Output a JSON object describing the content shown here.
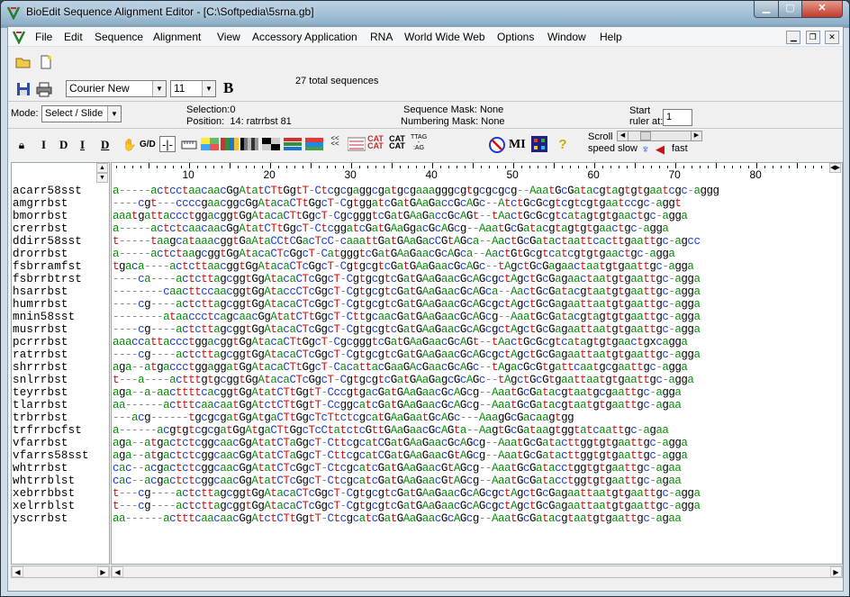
{
  "window": {
    "title": "BioEdit Sequence Alignment Editor - [C:\\Softpedia\\5srna.gb]"
  },
  "menu": [
    "File",
    "Edit",
    "Sequence",
    "Alignment",
    "View",
    "Accessory Application",
    "RNA",
    "World Wide Web",
    "Options",
    "Window",
    "Help"
  ],
  "toolbar": {
    "font_name": "Courier New",
    "font_size": "11",
    "bold_label": "B",
    "total_sequences": "27 total sequences"
  },
  "status": {
    "mode_label": "Mode:",
    "mode_value": "Select / Slide",
    "selection_label": "Selection:",
    "selection_value": "0",
    "position_label": "Position:",
    "position_value": "14:  ratrrbst  81",
    "sequence_mask": "Sequence Mask: None",
    "numbering_mask": "Numbering Mask: None",
    "start_ruler_label_1": "Start",
    "start_ruler_label_2": "ruler at:",
    "start_ruler_value": "1",
    "scroll_speed_1": "Scroll",
    "scroll_speed_2": "speed",
    "slow": "slow",
    "fast": "fast"
  },
  "tools_row": [
    "I",
    "D",
    "I",
    "D",
    "G/D",
    "MI"
  ],
  "ruler": [
    "10",
    "20",
    "30",
    "40",
    "50",
    "60",
    "70",
    "80"
  ],
  "sequences": [
    {
      "name": "acarr58sst",
      "seq": "a-----actcctaacaacGgAtatCTtGgtT-Ctcgcgaggcgatgcgaaagggcgtgcgcgcg--AaatGcGatacgtagtgtgaatcgc-aggg"
    },
    {
      "name": "amgrrbst",
      "seq": "----cgt---ccccgaacggcGgAtacaCTtGgcT-CgtggatcGatGAaGaccGcAGc--AtctGcGcgtcgtcgtgaatccgc-aggt"
    },
    {
      "name": "bmorrbst",
      "seq": "aaatgattaccctggacggtGgAtacaCTtGgcT-CgcgggtcGatGAaGaccGcAGt--tAactGcGcgtcatagtgtgaactgc-agga"
    },
    {
      "name": "crerrbst",
      "seq": "a-----actctcaacaacGgAtatCTtGgcT-CtcggatcGatGAaGgacGcAGcg--AaatGcGatacgtagtgtgaactgc-agga"
    },
    {
      "name": "ddirr58sst",
      "seq": "t-----taagcataaacggtGaAtaCCtCGacTcC-caaattGatGAaGacCGtAGca--AactGcGatactaattcacttgaattgc-agcc"
    },
    {
      "name": "drorrbst",
      "seq": "a-----actctaagcggtGgAtacaCTcGgcT-CatgggtcGatGAaGaacGcAGca--AactGtGcgtcatcgtgtgaactgc-agga"
    },
    {
      "name": "fsbrramfst",
      "seq": "tgaca----actcttaacggtGgAtacaCTcGgcT-CgtgcgtcGatGAaGaacGcAGc--tAgctGcGagaactaatgtgaattgc-agga"
    },
    {
      "name": "fsbrrbtrst",
      "seq": "----ca----actcttagcggtGgAtacaCTcGgcT-CgtgcgtcGatGAaGaacGcAGcgctAgctGcGagaactaatgtgaattgc-agga"
    },
    {
      "name": "hsarrbst",
      "seq": "--------caacttccaacggtGgAtaccCTcGgcT-CgtgcgtcGatGAaGaacGcAGca--AactGcGatacgtaatgtgaattgc-agga"
    },
    {
      "name": "humrrbst",
      "seq": "----cg----actcttagcggtGgAtacaCTcGgcT-CgtgcgtcGatGAaGaacGcAGcgctAgctGcGagaattaatgtgaattgc-agga"
    },
    {
      "name": "mnin58sst",
      "seq": "--------ataaccctcagcaacGgAtatCTtGgcT-CttgcaacGatGAaGaacGcAGcg--AaatGcGatacgtagtgtgaattgc-agga"
    },
    {
      "name": "musrrbst",
      "seq": "----cg----actcttagcggtGgAtacaCTcGgcT-CgtgcgtcGatGAaGaacGcAGcgctAgctGcGagaattaatgtgaattgc-agga"
    },
    {
      "name": "pcrrrbst",
      "seq": "aaaccattaccctggacggtGgAtacaCTtGgcT-CgcgggtcGatGAaGaacGcAGt--tAactGcGcgtcatagtgtgaactgxcagga"
    },
    {
      "name": "ratrrbst",
      "seq": "----cg----actcttagcggtGgAtacaCTcGgcT-CgtgcgtcGatGAaGaacGcAGcgctAgctGcGagaattaatgtgaattgc-agga"
    },
    {
      "name": "shrrrbst",
      "seq": "aga--atgaccctggaggatGgAtacaCTtGgcT-CacattacGaaGAcGaacGcAGc--tAgacGcGtgattcaatgcgaattgc-agga"
    },
    {
      "name": "snlrrbst",
      "seq": "t---a----actttgtgcggtGgAtacaCTcGgcT-CgtgcgtcGatGAaGagcGcAGc--tAgctGcGtgaattaatgtgaattgc-agga"
    },
    {
      "name": "teyrrbst",
      "seq": "aga--a-aacttttcacggtGgAtatCTtGgtT-CccgtgacGatGAaGaacGcAGcg--AaatGcGatacgtaatgcgaattgc-agga"
    },
    {
      "name": "tlarrbst",
      "seq": "aa------actttcaacaatGgAtctCTtGgtT-CcggcatcGatGAaGaacGcAGcg--AaatGcGatacgtaatgtgaattgc-agaa"
    },
    {
      "name": "trbrrbst",
      "seq": "---acg------tgcgcgatGgAtgaCTtGgcTcTtctcgcatGAaGaatGcAGc---AaagGcGacaagtgg"
    },
    {
      "name": "trfrrbcfst",
      "seq": "a------acgtgtcgcgatGgAtgaCTtGgcTcCtatctcGttGAaGaacGcAGta--AagtGcGataagtggtatcaattgc-agaa"
    },
    {
      "name": "vfarrbst",
      "seq": "aga--atgactctcggcaacGgAtatCTaGgcT-CttcgcatCGatGAaGaacGcAGcg--AaatGcGatacttggtgtgaattgc-agga"
    },
    {
      "name": "vfarrs58sst",
      "seq": "aga--atgactctcggcaacGgAtatCTaGgcT-CttcgcatCGatGAaGaacGtAGcg--AaatGcGatacttggtgtgaattgc-agga"
    },
    {
      "name": "whtrrbst",
      "seq": "cac--acgactctcggcaacGgAtatCTcGgcT-CtcgcatcGatGAaGaacGtAGcg--AaatGcGatacctggtgtgaattgc-agaa"
    },
    {
      "name": "whtrrblst",
      "seq": "cac--acgactctcggcaacGgAtatCTcGgcT-CtcgcatcGatGAaGaacGtAGcg--AaatGcGatacctggtgtgaattgc-agaa"
    },
    {
      "name": "xebrrbbst",
      "seq": "t---cg----actcttagcggtGgAtacaCTcGgcT-CgtgcgtcGatGAaGaacGcAGcgctAgctGcGagaattaatgtgaattgc-agga"
    },
    {
      "name": "xelrrblst",
      "seq": "t---cg----actcttagcggtGgAtacaCTcGgcT-CgtgcgtcGatGAaGaacGcAGcgctAgctGcGagaattaatgtgaattgc-agga"
    },
    {
      "name": "yscrrbst",
      "seq": "aa------actttcaacaacGgAtctCTtGgtT-CtcgcatcGatGAaGaacGcAGcg--AaatGcGatacgtaatgtgaattgc-agaa"
    }
  ]
}
